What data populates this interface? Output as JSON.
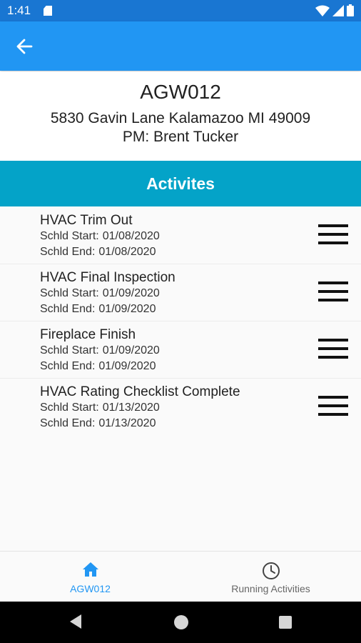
{
  "status_bar": {
    "time": "1:41",
    "icons": [
      "sd-card-icon",
      "wifi-icon",
      "signal-icon",
      "battery-icon"
    ]
  },
  "app_bar": {
    "back_icon": "arrow-left-icon",
    "color": "#2196f3"
  },
  "header": {
    "job_id": "AGW012",
    "address": "5830 Gavin Lane Kalamazoo MI 49009",
    "pm": "PM: Brent Tucker"
  },
  "section": {
    "title": "Activites",
    "color": "#04a3c8"
  },
  "activities": [
    {
      "title": "HVAC Trim Out",
      "start_label": "Schld Start:",
      "start": "01/08/2020",
      "end_label": "Schld End:",
      "end": "01/08/2020"
    },
    {
      "title": "HVAC Final Inspection",
      "start_label": "Schld Start:",
      "start": "01/09/2020",
      "end_label": "Schld End:",
      "end": "01/09/2020"
    },
    {
      "title": "Fireplace Finish",
      "start_label": "Schld Start:",
      "start": "01/09/2020",
      "end_label": "Schld End:",
      "end": "01/09/2020"
    },
    {
      "title": "HVAC Rating Checklist Complete",
      "start_label": "Schld Start:",
      "start": "01/13/2020",
      "end_label": "Schld End:",
      "end": "01/13/2020"
    }
  ],
  "bottom_nav": {
    "tabs": [
      {
        "label": "AGW012",
        "icon": "home-icon",
        "active": true
      },
      {
        "label": "Running Activities",
        "icon": "clock-icon",
        "active": false
      }
    ],
    "active_color": "#2196f3"
  },
  "system_nav": {
    "buttons": [
      "back-triangle-icon",
      "home-circle-icon",
      "recents-square-icon"
    ]
  }
}
